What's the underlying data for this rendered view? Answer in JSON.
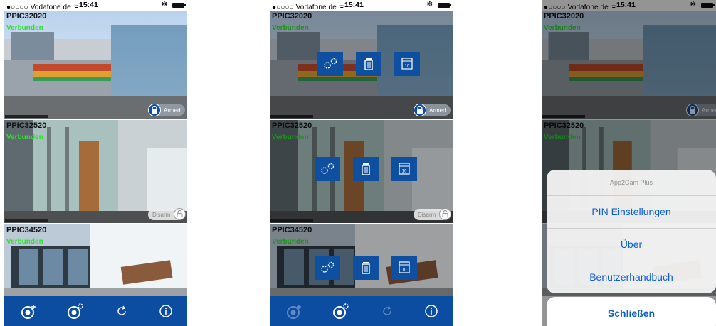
{
  "status_bar": {
    "carrier": "●○○○○ Vodafone.de ᯤ",
    "time": "15:41",
    "bluetooth": "✻"
  },
  "cameras": [
    {
      "name": "PPIC32020",
      "status": "Verbunden",
      "arm_label": "Armed"
    },
    {
      "name": "PPIC32520",
      "status": "Verbunden",
      "arm_label": "Disarm"
    },
    {
      "name": "PPIC34520",
      "status": "Verbunden"
    }
  ],
  "overlay_buttons": [
    "settings-gears-icon",
    "trash-icon",
    "calendar-icon"
  ],
  "calendar_day": "10",
  "toolbar": [
    "add-camera-icon",
    "camera-settings-icon",
    "refresh-icon",
    "info-icon"
  ],
  "action_sheet": {
    "title": "App2Cam Plus",
    "options": [
      "PIN Einstellungen",
      "Über",
      "Benutzerhandbuch"
    ],
    "cancel": "Schließen"
  },
  "colors": {
    "brand_blue": "#0c4da2",
    "connected_green": "#2ee02e",
    "ios_link_blue": "#0b5fd1"
  }
}
